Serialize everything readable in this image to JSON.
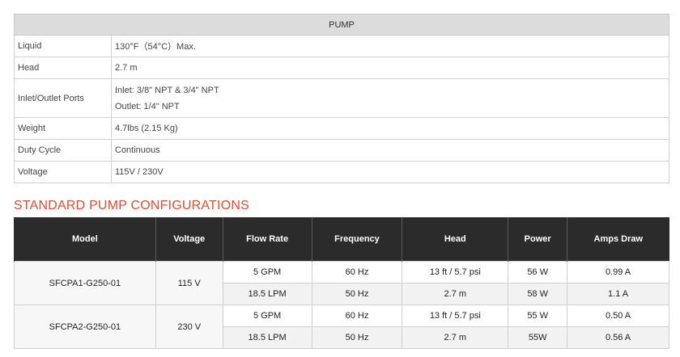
{
  "pump_table": {
    "header": "PUMP",
    "rows": [
      {
        "label": "Liquid",
        "values": [
          "130°F（54°C）Max."
        ]
      },
      {
        "label": "Head",
        "values": [
          "2.7 m"
        ]
      },
      {
        "label": "Inlet/Outlet Ports",
        "values": [
          "Inlet: 3/8\" NPT & 3/4\" NPT",
          "Outlet: 1/4\" NPT"
        ]
      },
      {
        "label": "Weight",
        "values": [
          "4.7lbs (2.15 Kg)"
        ]
      },
      {
        "label": "Duty Cycle",
        "values": [
          "Continuous"
        ]
      },
      {
        "label": "Voltage",
        "values": [
          "115V / 230V"
        ]
      }
    ]
  },
  "configurations": {
    "title": "STANDARD PUMP CONFIGURATIONS",
    "columns": [
      "Model",
      "Voltage",
      "Flow Rate",
      "Frequency",
      "Head",
      "Power",
      "Amps Draw"
    ],
    "models": [
      {
        "model": "SFCPA1-G250-01",
        "voltage": "115 V",
        "rows": [
          {
            "flow_rate": "5 GPM",
            "frequency": "60 Hz",
            "head": "13 ft / 5.7 psi",
            "power": "56 W",
            "amps": "0.99 A"
          },
          {
            "flow_rate": "18.5 LPM",
            "frequency": "50 Hz",
            "head": "2.7 m",
            "power": "58 W",
            "amps": "1.1 A"
          }
        ]
      },
      {
        "model": "SFCPA2-G250-01",
        "voltage": "230 V",
        "rows": [
          {
            "flow_rate": "5 GPM",
            "frequency": "60 Hz",
            "head": "13 ft / 5.7 psi",
            "power": "55 W",
            "amps": "0.50 A"
          },
          {
            "flow_rate": "18.5 LPM",
            "frequency": "50 Hz",
            "head": "2.7 m",
            "power": "55W",
            "amps": "0.56 A"
          }
        ]
      }
    ]
  },
  "colors": {
    "title_accent": "#e84a2c",
    "header_dark": "#2b2b2b",
    "header_light": "#dcdcdc",
    "row_alt": "#f2f2f2"
  }
}
